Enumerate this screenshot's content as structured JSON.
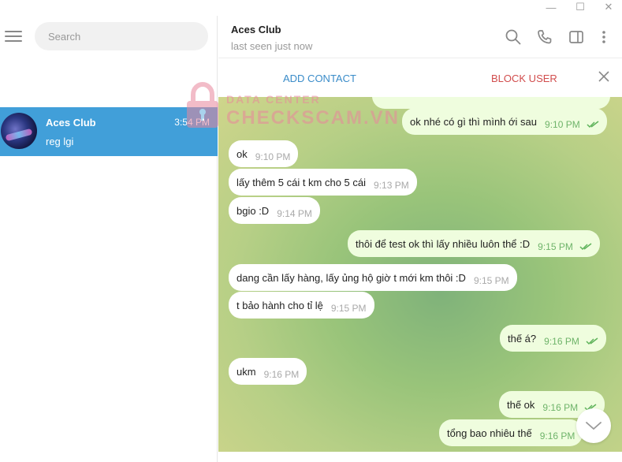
{
  "window": {
    "minimize": "—",
    "maximize": "☐",
    "close": "✕"
  },
  "sidebar": {
    "search_placeholder": "Search",
    "chats": [
      {
        "name": "Aces Club",
        "time": "3:54 PM",
        "preview": "reg lgi"
      }
    ]
  },
  "watermark": {
    "line1": "DATA CENTER",
    "line2": "CHECKSCAM.VN"
  },
  "header": {
    "title": "Aces Club",
    "status": "last seen just now"
  },
  "actions": {
    "add_contact": "ADD CONTACT",
    "block_user": "BLOCK USER"
  },
  "messages": [
    {
      "dir": "out",
      "text": "ok nhé có gì thì mình ới sau",
      "time": "9:10 PM",
      "read": true
    },
    {
      "dir": "in",
      "text": "ok",
      "time": "9:10 PM"
    },
    {
      "dir": "in",
      "text": "lấy thêm 5 cái t km cho 5 cái",
      "time": "9:13 PM"
    },
    {
      "dir": "in",
      "text": "bgio :D",
      "time": "9:14 PM"
    },
    {
      "dir": "out",
      "text": "thôi để test ok thì lấy nhiều luôn thể :D",
      "time": "9:15 PM",
      "read": true
    },
    {
      "dir": "in",
      "text": "dang cần lấy hàng, lấy ủng hộ giờ t mới km thôi :D",
      "time": "9:15 PM"
    },
    {
      "dir": "in",
      "text": "t bảo hành cho tỉ lệ",
      "time": "9:15 PM"
    },
    {
      "dir": "out",
      "text": "thế á?",
      "time": "9:16 PM",
      "read": true
    },
    {
      "dir": "in",
      "text": "ukm",
      "time": "9:16 PM"
    },
    {
      "dir": "out",
      "text": "thế ok",
      "time": "9:16 PM",
      "read": true
    },
    {
      "dir": "out",
      "text": "tổng bao nhiêu thế",
      "time": "9:16 PM",
      "read": false
    }
  ],
  "colors": {
    "selected_chat": "#419fd9",
    "outgoing_bubble": "#effdde",
    "add_contact": "#3a8cc9",
    "block_user": "#d14d4d"
  }
}
